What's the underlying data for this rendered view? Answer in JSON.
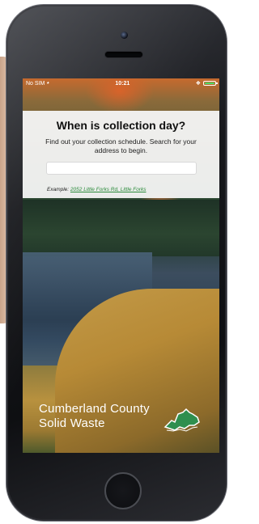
{
  "status_bar": {
    "carrier": "No SIM",
    "time": "10:21",
    "wifi_icon": "wifi-icon",
    "bluetooth_icon": "bluetooth-icon",
    "battery_icon": "battery-icon"
  },
  "card": {
    "title": "When is collection day?",
    "intro": "Find out your collection schedule. Search for your address to begin.",
    "search_placeholder": "",
    "example_label": "Example:",
    "example_link": "2052 Little Forks Rd, Little Forks"
  },
  "brand": {
    "line1": "Cumberland County",
    "line2": "Solid Waste",
    "logo_icon": "county-map-logo-icon"
  },
  "colors": {
    "link": "#2a8a3a",
    "battery": "#4cd964",
    "logo_green": "#2f8f4e"
  }
}
